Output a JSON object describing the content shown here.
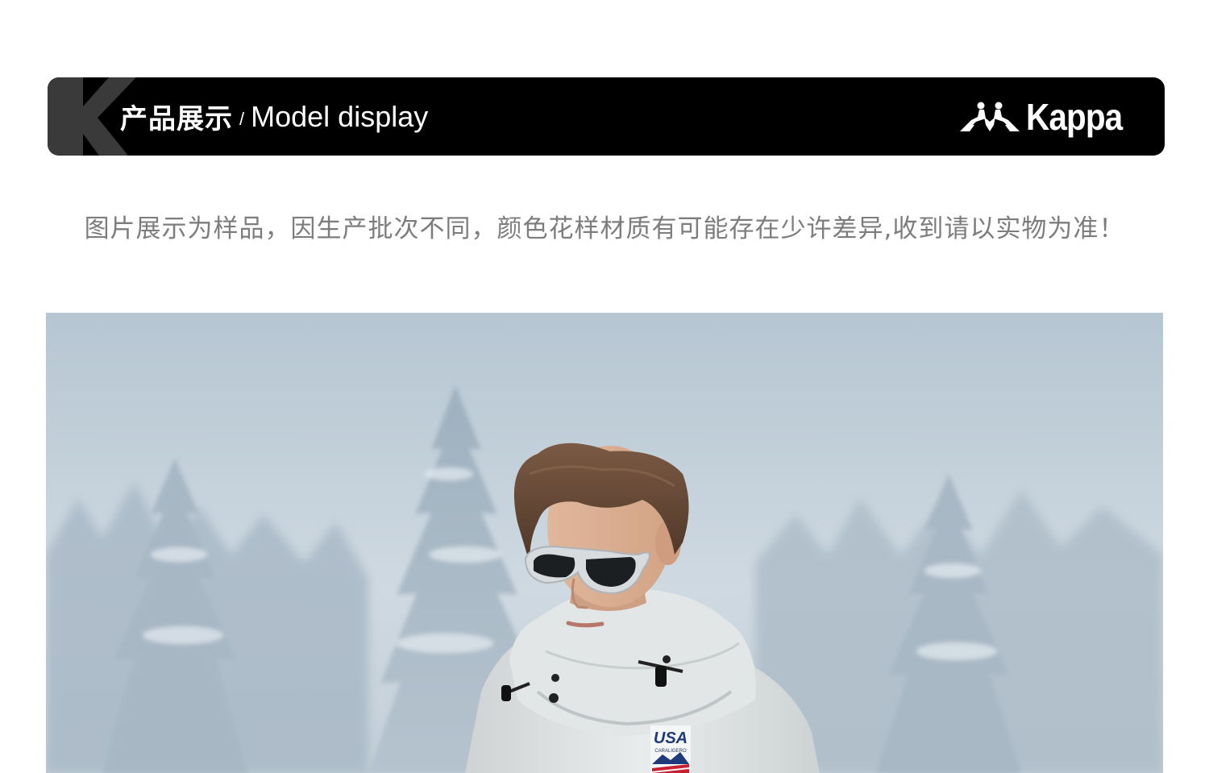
{
  "header": {
    "title_cn": "产品展示",
    "separator": "/",
    "title_en": "Model display",
    "brand_name": "Kappa",
    "brand_logo_icon": "kappa-omini-logo-icon",
    "k_mark_icon": "k-letter-mark-icon"
  },
  "notice": {
    "text": "图片展示为样品，因生产批次不同，颜色花样材质有可能存在少许差异,收到请以实物为准！"
  },
  "hero": {
    "jacket_badge_text": "USA",
    "jacket_badge_subtext": "CARALIGERO"
  },
  "colors": {
    "header_bg": "#000000",
    "header_text": "#ffffff",
    "k_mark": "#3a3a3a",
    "notice_text": "#7d7d7d",
    "sky": "#c4d1db"
  }
}
